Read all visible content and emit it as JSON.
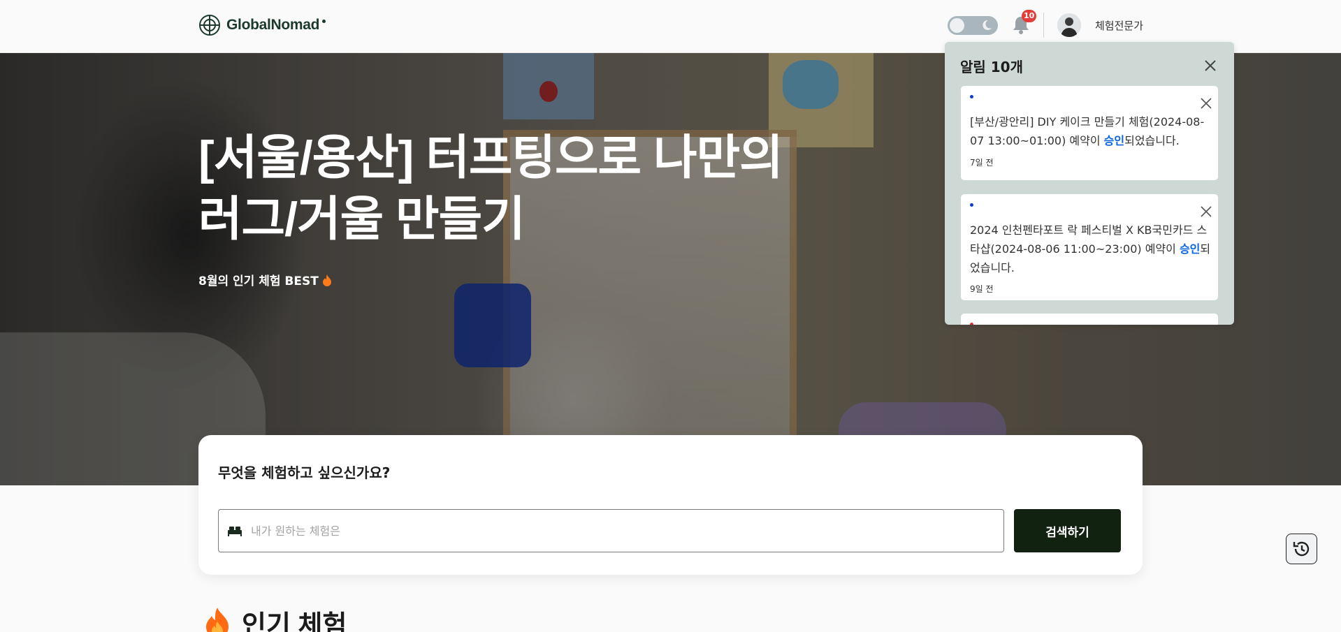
{
  "header": {
    "logo_text": "GlobalNomad",
    "notification_count": "10",
    "username": "체험전문가"
  },
  "hero": {
    "title": "[서울/용산] 터프팅으로 나만의 러그/거울 만들기",
    "subtitle": "8월의 인기 체험 BEST"
  },
  "search": {
    "question": "무엇을 체험하고 싶으신가요?",
    "placeholder": "내가 원하는 체험은",
    "button_label": "검색하기"
  },
  "popular": {
    "title": "인기 체험"
  },
  "notifications": {
    "title": "알림 10개",
    "items": [
      {
        "text_before": "[부산/광안리] DIY 케이크 만들기 체험(2024-08-07 13:00~01:00) 예약이 ",
        "status": "승인",
        "text_after": "되었습니다.",
        "time": "7일 전",
        "dot_color": "#0b3bd6"
      },
      {
        "text_before": "2024 인천펜타포트 락 페스티벌 X KB국민카드 스타샵(2024-08-06 11:00~23:00) 예약이 ",
        "status": "승인",
        "text_after": "되었습니다.",
        "time": "9일 전",
        "dot_color": "#0b3bd6"
      },
      {
        "dot_color": "#e03131"
      }
    ]
  },
  "colors": {
    "primary_dark": "#112211",
    "highlight_blue": "#0a64e0",
    "badge_red": "#e43b3b",
    "panel_bg": "#ced8d5"
  }
}
